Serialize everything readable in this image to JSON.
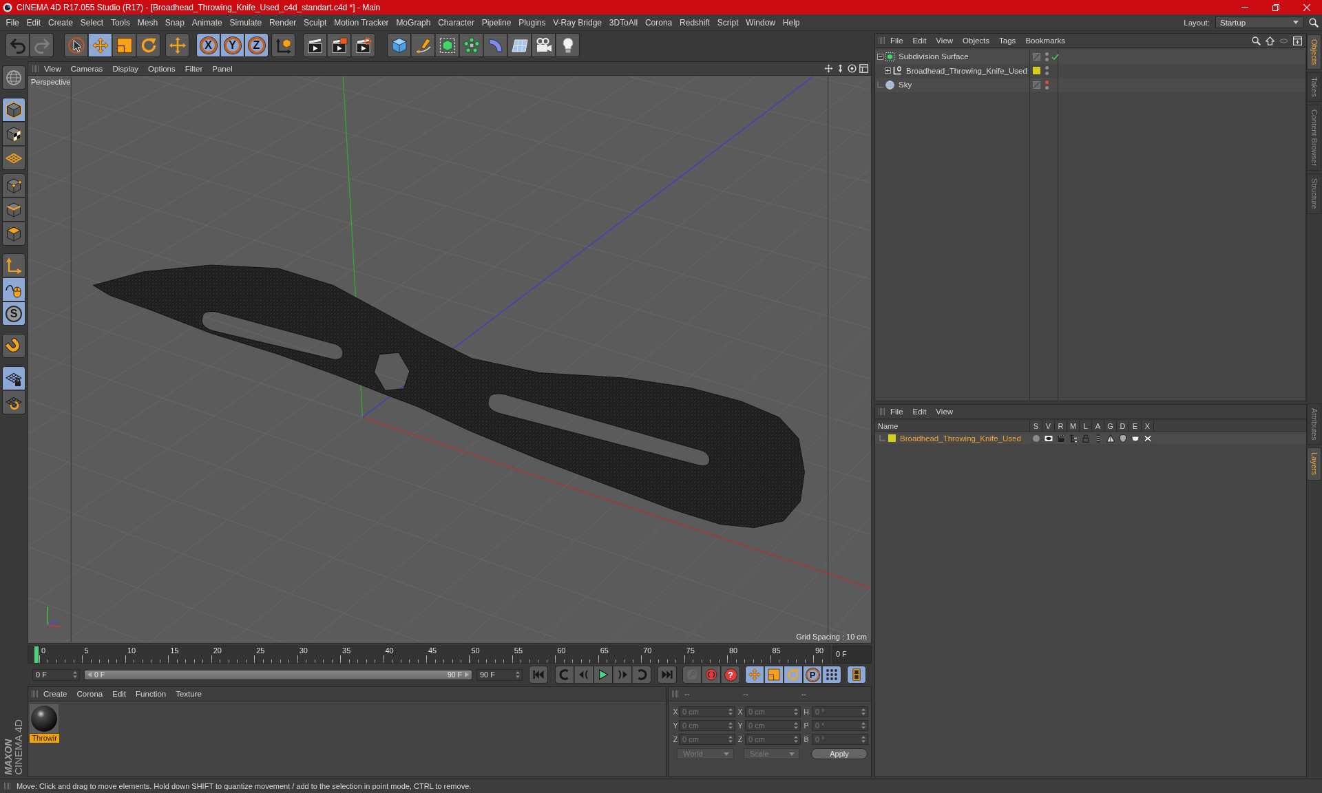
{
  "window": {
    "title": "CINEMA 4D R17.055 Studio (R17) - [Broadhead_Throwing_Knife_Used_c4d_standart.c4d *] - Main"
  },
  "menu_bar": {
    "items": [
      "File",
      "Edit",
      "Create",
      "Select",
      "Tools",
      "Mesh",
      "Snap",
      "Animate",
      "Simulate",
      "Render",
      "Sculpt",
      "Motion Tracker",
      "MoGraph",
      "Character",
      "Pipeline",
      "Plugins",
      "V-Ray Bridge",
      "3DToAll",
      "Corona",
      "Redshift",
      "Script",
      "Window",
      "Help"
    ],
    "layout_label": "Layout:",
    "layout_value": "Startup"
  },
  "toolbar": {
    "groups": [
      [
        {
          "selected": false,
          "disabled": false
        },
        {
          "selected": false,
          "disabled": true
        }
      ],
      [
        {
          "selected": false,
          "disabled": false
        },
        {
          "selected": true,
          "disabled": false
        },
        {
          "selected": false,
          "disabled": false
        },
        {
          "selected": false,
          "disabled": false
        }
      ],
      [
        {
          "selected": false,
          "disabled": false
        }
      ],
      [
        {
          "label": "X",
          "selected": true,
          "disabled": false
        },
        {
          "label": "Y",
          "selected": true,
          "disabled": false
        },
        {
          "label": "Z",
          "selected": true,
          "disabled": false
        }
      ],
      [
        {
          "selected": false,
          "disabled": false
        }
      ],
      [
        {
          "selected": false,
          "disabled": false
        },
        {
          "selected": false,
          "disabled": false
        },
        {
          "selected": false,
          "disabled": false
        }
      ],
      [
        {
          "selected": false,
          "disabled": false
        },
        {
          "selected": false,
          "disabled": false
        },
        {
          "selected": false,
          "disabled": false
        },
        {
          "selected": false,
          "disabled": false
        },
        {
          "selected": false,
          "disabled": false
        },
        {
          "selected": false,
          "disabled": false
        },
        {
          "selected": false,
          "disabled": false
        },
        {
          "selected": false,
          "disabled": false
        }
      ]
    ]
  },
  "mode_palette": {
    "groups": [
      [
        {
          "selected": false
        }
      ],
      [
        {
          "selected": true
        },
        {
          "selected": false
        },
        {
          "selected": false
        }
      ],
      [
        {
          "selected": false
        },
        {
          "selected": false
        },
        {
          "selected": false
        }
      ],
      [
        {
          "selected": false
        },
        {
          "selected": true
        },
        {
          "label": "S",
          "selected": true
        }
      ],
      [
        {
          "selected": false
        }
      ],
      [
        {
          "selected": true
        },
        {
          "selected": false
        }
      ]
    ]
  },
  "viewport": {
    "menu": [
      "View",
      "Cameras",
      "Display",
      "Options",
      "Filter",
      "Panel"
    ],
    "camera": "Perspective",
    "grid_spacing": "Grid Spacing : 10 cm"
  },
  "timeline": {
    "ticks": [
      "0",
      "5",
      "10",
      "15",
      "20",
      "25",
      "30",
      "35",
      "40",
      "45",
      "50",
      "55",
      "60",
      "65",
      "70",
      "75",
      "80",
      "85",
      "90"
    ],
    "playhead": {
      "level": 0
    },
    "current_frame": "0 F"
  },
  "range": {
    "start": "0 F",
    "slider_start": "0 F",
    "slider_end": "90 F",
    "end": "90 F",
    "level": 1
  },
  "transport": {
    "groups": [
      [
        {
          "selected": false,
          "disabled": false
        }
      ],
      [
        {
          "selected": false,
          "disabled": false
        },
        {
          "selected": false,
          "disabled": false
        },
        {
          "selected": false,
          "disabled": false
        },
        {
          "selected": false,
          "disabled": false
        },
        {
          "selected": false,
          "disabled": false
        }
      ],
      [
        {
          "selected": false,
          "disabled": false
        }
      ],
      [
        {
          "selected": false,
          "disabled": true
        },
        {
          "selected": false,
          "disabled": false
        },
        {
          "label": "?",
          "selected": false,
          "disabled": false
        }
      ],
      [
        {
          "selected": true,
          "disabled": false
        },
        {
          "selected": true,
          "disabled": false
        },
        {
          "selected": true,
          "disabled": false
        },
        {
          "label": "P",
          "selected": true,
          "disabled": false
        },
        {
          "selected": true,
          "disabled": false
        }
      ],
      [
        {
          "selected": true,
          "disabled": false
        }
      ]
    ]
  },
  "material_manager": {
    "menu": [
      "Create",
      "Corona",
      "Edit",
      "Function",
      "Texture"
    ],
    "materials": [
      {
        "name": "Throwir",
        "selected": true
      }
    ]
  },
  "coordinates": {
    "disabled": true,
    "headers": [
      "--",
      "--",
      "--"
    ],
    "rows": [
      {
        "position_label": "X",
        "position": "0 cm",
        "size_label": "X",
        "size": "0 cm",
        "rotation_label": "H",
        "rotation": "0 °"
      },
      {
        "position_label": "Y",
        "position": "0 cm",
        "size_label": "Y",
        "size": "0 cm",
        "rotation_label": "P",
        "rotation": "0 °"
      },
      {
        "position_label": "Z",
        "position": "0 cm",
        "size_label": "Z",
        "size": "0 cm",
        "rotation_label": "B",
        "rotation": "0 °"
      }
    ],
    "space": "World",
    "size_mode": "Scale",
    "apply": "Apply"
  },
  "object_manager": {
    "menu": [
      "File",
      "Edit",
      "View",
      "Objects",
      "Tags",
      "Bookmarks"
    ],
    "objects": [
      {
        "kind": "subdivision",
        "name": "Subdivision Surface",
        "expanded": true,
        "editor_hidden": false,
        "render_hidden": false,
        "enabled": true,
        "children": [
          {
            "kind": "null",
            "name": "Broadhead_Throwing_Knife_Used",
            "expanded": false,
            "color": "#d4cf1f",
            "editor_hidden": false,
            "render_hidden": false
          }
        ]
      },
      {
        "kind": "sky",
        "name": "Sky",
        "editor_hidden": true,
        "render_hidden": false
      }
    ]
  },
  "layer_manager": {
    "menu": [
      "File",
      "Edit",
      "View"
    ],
    "columns": [
      "Name",
      "S",
      "V",
      "R",
      "M",
      "L",
      "A",
      "G",
      "D",
      "E",
      "X"
    ],
    "layers": [
      {
        "name": "Broadhead_Throwing_Knife_Used",
        "color": "#d4cf1f",
        "selected": true
      }
    ]
  },
  "side_tabs": {
    "upper": [
      {
        "label": "Objects",
        "selected": true
      },
      {
        "label": "Takes",
        "selected": false
      },
      {
        "label": "Content Browser",
        "selected": false
      },
      {
        "label": "Structure",
        "selected": false
      }
    ],
    "lower": [
      {
        "label": "Attributes",
        "selected": false
      },
      {
        "label": "Layers",
        "selected": true
      }
    ]
  },
  "logo": {
    "brand": "MAXON",
    "product": "CINEMA 4D"
  },
  "status_bar": {
    "text": "Move: Click and drag to move elements. Hold down SHIFT to quantize movement / add to the selection in point mode, CTRL to remove."
  }
}
